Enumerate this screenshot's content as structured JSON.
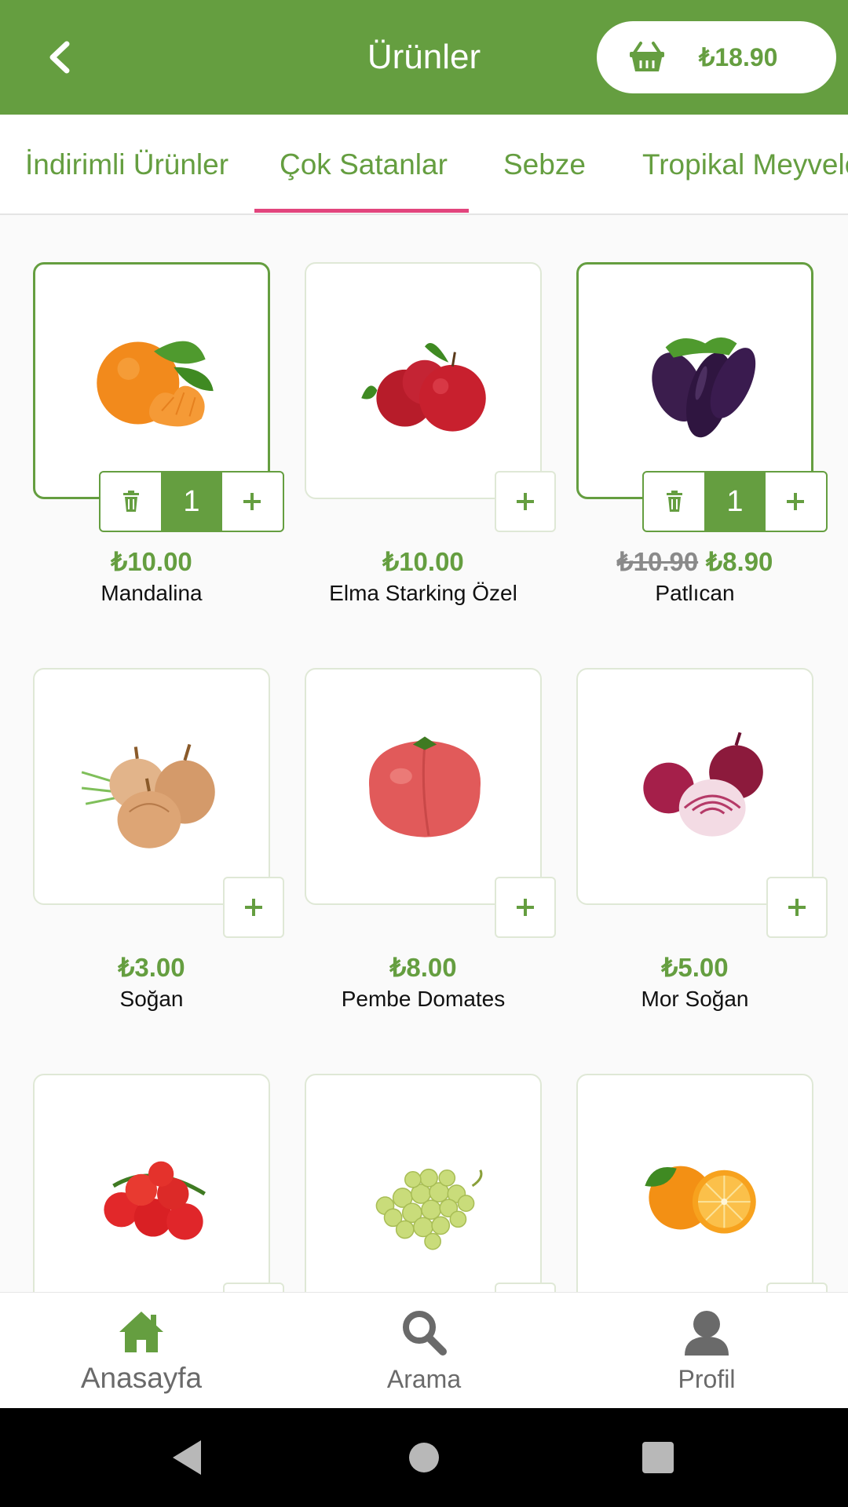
{
  "header": {
    "title": "Ürünler",
    "cart_total": "₺18.90",
    "back_icon": "chevron-left-icon",
    "cart_icon": "basket-icon",
    "color": "#659e40"
  },
  "tabs": [
    {
      "label": "İndirimli Ürünler"
    },
    {
      "label": "Çok Satanlar",
      "selected": true
    },
    {
      "label": "Sebze"
    },
    {
      "label": "Tropikal Meyveler"
    }
  ],
  "tab_indicator_color": "#e2457d",
  "products": [
    {
      "name": "Mandalina",
      "price": "₺10.00",
      "old_price": "",
      "qty": "1",
      "image": "mandarin"
    },
    {
      "name": "Elma Starking Özel",
      "price": "₺10.00",
      "old_price": "",
      "qty": "",
      "image": "apple"
    },
    {
      "name": "Patlıcan",
      "price": "₺8.90",
      "old_price": "₺10.90",
      "qty": "1",
      "image": "eggplant"
    },
    {
      "name": "Soğan",
      "price": "₺3.00",
      "old_price": "",
      "qty": "",
      "image": "onion"
    },
    {
      "name": "Pembe Domates",
      "price": "₺8.00",
      "old_price": "",
      "qty": "",
      "image": "tomato"
    },
    {
      "name": "Mor Soğan",
      "price": "₺5.00",
      "old_price": "",
      "qty": "",
      "image": "red-onion"
    },
    {
      "name": "",
      "price": "",
      "old_price": "",
      "qty": "",
      "image": "cherry-tomato"
    },
    {
      "name": "",
      "price": "",
      "old_price": "",
      "qty": "",
      "image": "grapes"
    },
    {
      "name": "",
      "price": "",
      "old_price": "",
      "qty": "",
      "image": "orange"
    }
  ],
  "bottom_nav": [
    {
      "label": "Anasayfa",
      "icon": "home-icon",
      "active": true
    },
    {
      "label": "Arama",
      "icon": "search-icon"
    },
    {
      "label": "Profil",
      "icon": "profile-icon"
    }
  ],
  "system_nav": [
    "back-icon",
    "home-circle-icon",
    "recents-icon"
  ]
}
